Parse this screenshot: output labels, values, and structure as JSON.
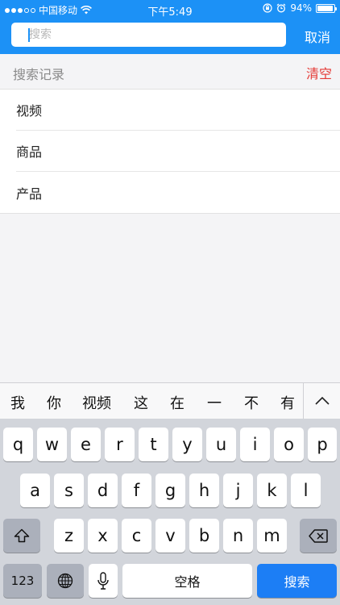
{
  "status_bar": {
    "carrier": "中国移动",
    "time": "下午5:49",
    "battery_percent": "94%",
    "battery_level": 0.94
  },
  "header": {
    "search_placeholder": "搜索",
    "cancel_label": "取消"
  },
  "history": {
    "title": "搜索记录",
    "clear_label": "清空",
    "items": [
      "视频",
      "商品",
      "产品"
    ]
  },
  "keyboard": {
    "candidates": [
      "我",
      "你",
      "视频",
      "这",
      "在",
      "一",
      "不",
      "有"
    ],
    "row1": [
      "q",
      "w",
      "e",
      "r",
      "t",
      "y",
      "u",
      "i",
      "o",
      "p"
    ],
    "row2": [
      "a",
      "s",
      "d",
      "f",
      "g",
      "h",
      "j",
      "k",
      "l"
    ],
    "row3": [
      "z",
      "x",
      "c",
      "v",
      "b",
      "n",
      "m"
    ],
    "numbers_label": "123",
    "space_label": "空格",
    "search_label": "搜索"
  },
  "colors": {
    "accent": "#1c91f6",
    "clear": "#e53935",
    "keyboard_bg": "#d2d5db"
  }
}
